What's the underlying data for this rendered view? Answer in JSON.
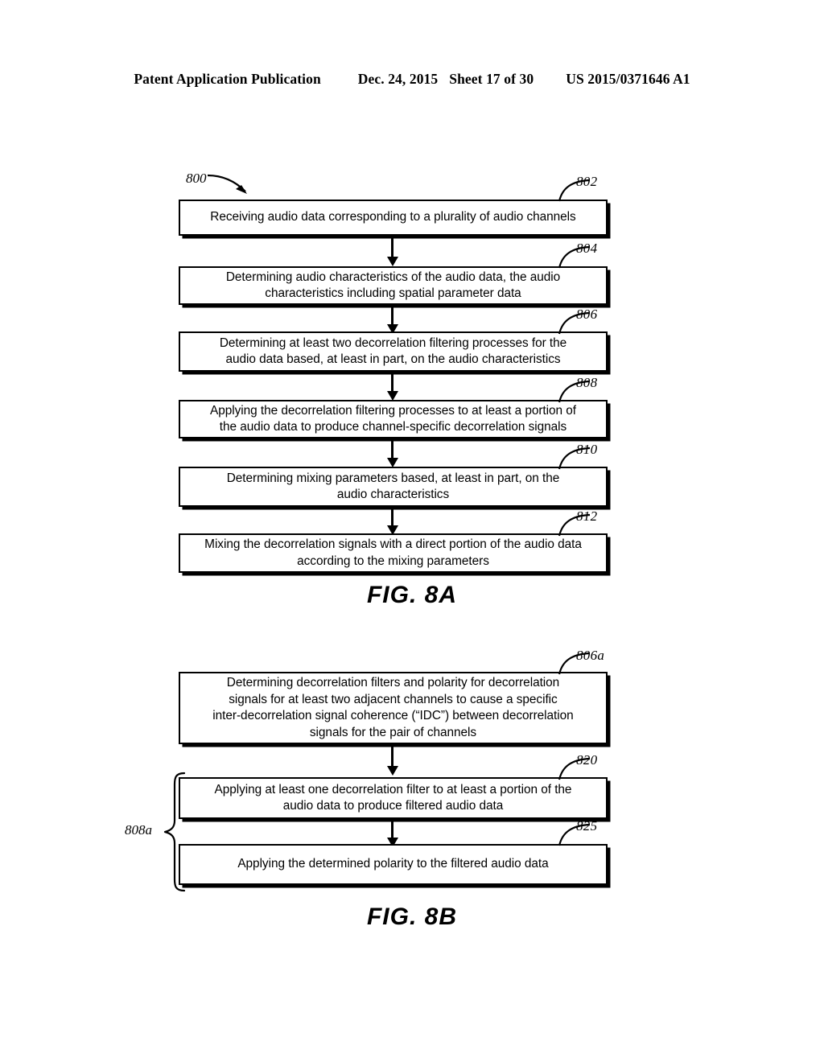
{
  "header": {
    "publication": "Patent Application Publication",
    "date": "Dec. 24, 2015",
    "sheet": "Sheet 17 of 30",
    "patent_number": "US 2015/0371646 A1"
  },
  "figures": [
    {
      "id": "fig-8a",
      "caption": "FIG. 8A",
      "origin_ref": "800",
      "boxes": [
        {
          "ref": "802",
          "text": "Receiving audio data corresponding to a plurality of audio channels"
        },
        {
          "ref": "804",
          "text": "Determining audio characteristics of the audio data, the audio\ncharacteristics including spatial parameter data"
        },
        {
          "ref": "806",
          "text": "Determining at least two decorrelation filtering processes for the\naudio data based, at least in part, on the audio characteristics"
        },
        {
          "ref": "808",
          "text": "Applying the decorrelation filtering processes to at least a portion of\nthe audio data to produce channel-specific decorrelation signals"
        },
        {
          "ref": "810",
          "text": "Determining mixing parameters based, at least in part, on the\naudio characteristics"
        },
        {
          "ref": "812",
          "text": "Mixing the decorrelation signals with a direct portion of the audio data\naccording to the mixing parameters"
        }
      ]
    },
    {
      "id": "fig-8b",
      "caption": "FIG. 8B",
      "group_brace_label": "808a",
      "boxes": [
        {
          "ref": "806a",
          "text": "Determining decorrelation filters and polarity for decorrelation\nsignals for at least two adjacent channels to cause a specific\ninter-decorrelation signal coherence (“IDC”) between decorrelation\nsignals for the pair of channels"
        },
        {
          "ref": "820",
          "text": "Applying at least one decorrelation filter to at least a portion of the\naudio data to produce filtered audio data"
        },
        {
          "ref": "825",
          "text": "Applying the determined polarity to the filtered audio data"
        }
      ]
    }
  ]
}
